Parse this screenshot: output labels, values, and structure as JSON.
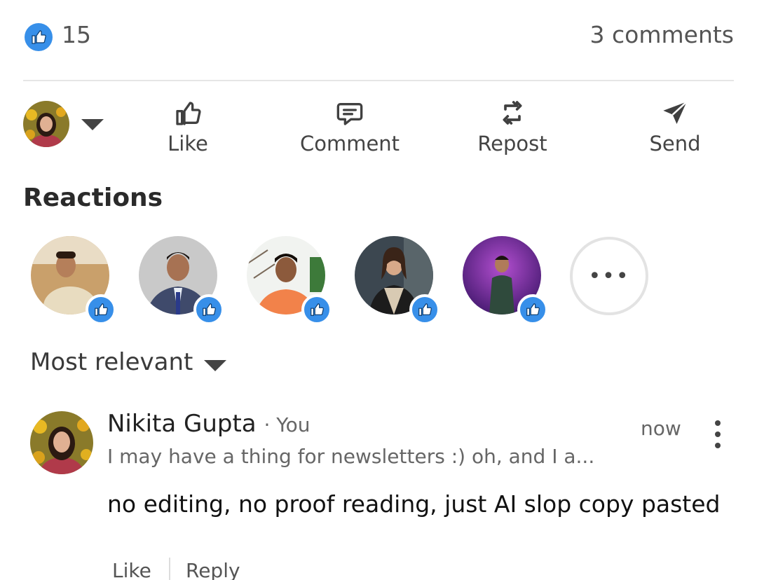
{
  "summary": {
    "reaction_icon": "thumbs-up-icon",
    "reaction_count": "15",
    "comments_count": "3 comments",
    "accent_color": "#378fe9"
  },
  "actions": {
    "like_label": "Like",
    "comment_label": "Comment",
    "repost_label": "Repost",
    "send_label": "Send"
  },
  "reactions": {
    "title": "Reactions",
    "more_label": "•••"
  },
  "sort": {
    "label": "Most relevant"
  },
  "comment": {
    "author": "Nikita Gupta",
    "you_tag": "· You",
    "headline": "I may have a thing for newsletters :) oh, and I a...",
    "time": "now",
    "body": "no editing, no proof reading, just AI slop copy pasted",
    "like_label": "Like",
    "reply_label": "Reply"
  }
}
